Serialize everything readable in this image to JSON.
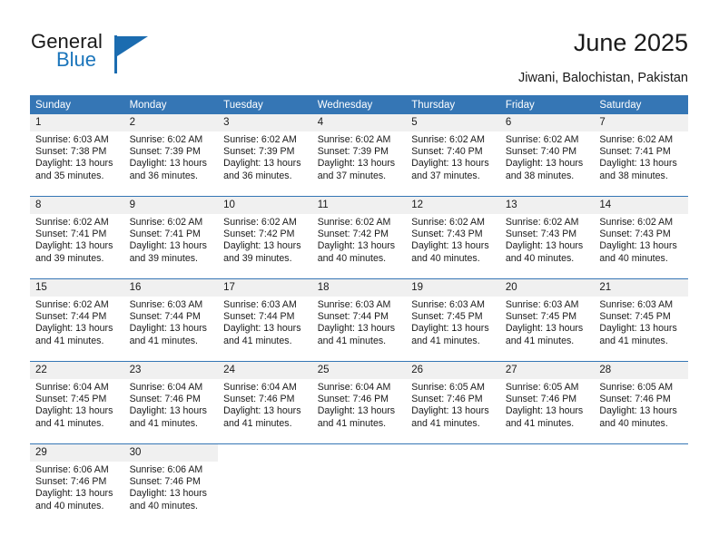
{
  "brand": {
    "name_part1": "General",
    "name_part2": "Blue",
    "accent_color": "#1b75bb"
  },
  "header": {
    "title": "June 2025",
    "location": "Jiwani, Balochistan, Pakistan"
  },
  "calendar": {
    "header_bg": "#3576b5",
    "daynum_bg": "#f0f0f0",
    "weekday_headers": [
      "Sunday",
      "Monday",
      "Tuesday",
      "Wednesday",
      "Thursday",
      "Friday",
      "Saturday"
    ],
    "weeks": [
      [
        {
          "day": "1",
          "sunrise": "Sunrise: 6:03 AM",
          "sunset": "Sunset: 7:38 PM",
          "daylight_line1": "Daylight: 13 hours",
          "daylight_line2": "and 35 minutes."
        },
        {
          "day": "2",
          "sunrise": "Sunrise: 6:02 AM",
          "sunset": "Sunset: 7:39 PM",
          "daylight_line1": "Daylight: 13 hours",
          "daylight_line2": "and 36 minutes."
        },
        {
          "day": "3",
          "sunrise": "Sunrise: 6:02 AM",
          "sunset": "Sunset: 7:39 PM",
          "daylight_line1": "Daylight: 13 hours",
          "daylight_line2": "and 36 minutes."
        },
        {
          "day": "4",
          "sunrise": "Sunrise: 6:02 AM",
          "sunset": "Sunset: 7:39 PM",
          "daylight_line1": "Daylight: 13 hours",
          "daylight_line2": "and 37 minutes."
        },
        {
          "day": "5",
          "sunrise": "Sunrise: 6:02 AM",
          "sunset": "Sunset: 7:40 PM",
          "daylight_line1": "Daylight: 13 hours",
          "daylight_line2": "and 37 minutes."
        },
        {
          "day": "6",
          "sunrise": "Sunrise: 6:02 AM",
          "sunset": "Sunset: 7:40 PM",
          "daylight_line1": "Daylight: 13 hours",
          "daylight_line2": "and 38 minutes."
        },
        {
          "day": "7",
          "sunrise": "Sunrise: 6:02 AM",
          "sunset": "Sunset: 7:41 PM",
          "daylight_line1": "Daylight: 13 hours",
          "daylight_line2": "and 38 minutes."
        }
      ],
      [
        {
          "day": "8",
          "sunrise": "Sunrise: 6:02 AM",
          "sunset": "Sunset: 7:41 PM",
          "daylight_line1": "Daylight: 13 hours",
          "daylight_line2": "and 39 minutes."
        },
        {
          "day": "9",
          "sunrise": "Sunrise: 6:02 AM",
          "sunset": "Sunset: 7:41 PM",
          "daylight_line1": "Daylight: 13 hours",
          "daylight_line2": "and 39 minutes."
        },
        {
          "day": "10",
          "sunrise": "Sunrise: 6:02 AM",
          "sunset": "Sunset: 7:42 PM",
          "daylight_line1": "Daylight: 13 hours",
          "daylight_line2": "and 39 minutes."
        },
        {
          "day": "11",
          "sunrise": "Sunrise: 6:02 AM",
          "sunset": "Sunset: 7:42 PM",
          "daylight_line1": "Daylight: 13 hours",
          "daylight_line2": "and 40 minutes."
        },
        {
          "day": "12",
          "sunrise": "Sunrise: 6:02 AM",
          "sunset": "Sunset: 7:43 PM",
          "daylight_line1": "Daylight: 13 hours",
          "daylight_line2": "and 40 minutes."
        },
        {
          "day": "13",
          "sunrise": "Sunrise: 6:02 AM",
          "sunset": "Sunset: 7:43 PM",
          "daylight_line1": "Daylight: 13 hours",
          "daylight_line2": "and 40 minutes."
        },
        {
          "day": "14",
          "sunrise": "Sunrise: 6:02 AM",
          "sunset": "Sunset: 7:43 PM",
          "daylight_line1": "Daylight: 13 hours",
          "daylight_line2": "and 40 minutes."
        }
      ],
      [
        {
          "day": "15",
          "sunrise": "Sunrise: 6:02 AM",
          "sunset": "Sunset: 7:44 PM",
          "daylight_line1": "Daylight: 13 hours",
          "daylight_line2": "and 41 minutes."
        },
        {
          "day": "16",
          "sunrise": "Sunrise: 6:03 AM",
          "sunset": "Sunset: 7:44 PM",
          "daylight_line1": "Daylight: 13 hours",
          "daylight_line2": "and 41 minutes."
        },
        {
          "day": "17",
          "sunrise": "Sunrise: 6:03 AM",
          "sunset": "Sunset: 7:44 PM",
          "daylight_line1": "Daylight: 13 hours",
          "daylight_line2": "and 41 minutes."
        },
        {
          "day": "18",
          "sunrise": "Sunrise: 6:03 AM",
          "sunset": "Sunset: 7:44 PM",
          "daylight_line1": "Daylight: 13 hours",
          "daylight_line2": "and 41 minutes."
        },
        {
          "day": "19",
          "sunrise": "Sunrise: 6:03 AM",
          "sunset": "Sunset: 7:45 PM",
          "daylight_line1": "Daylight: 13 hours",
          "daylight_line2": "and 41 minutes."
        },
        {
          "day": "20",
          "sunrise": "Sunrise: 6:03 AM",
          "sunset": "Sunset: 7:45 PM",
          "daylight_line1": "Daylight: 13 hours",
          "daylight_line2": "and 41 minutes."
        },
        {
          "day": "21",
          "sunrise": "Sunrise: 6:03 AM",
          "sunset": "Sunset: 7:45 PM",
          "daylight_line1": "Daylight: 13 hours",
          "daylight_line2": "and 41 minutes."
        }
      ],
      [
        {
          "day": "22",
          "sunrise": "Sunrise: 6:04 AM",
          "sunset": "Sunset: 7:45 PM",
          "daylight_line1": "Daylight: 13 hours",
          "daylight_line2": "and 41 minutes."
        },
        {
          "day": "23",
          "sunrise": "Sunrise: 6:04 AM",
          "sunset": "Sunset: 7:46 PM",
          "daylight_line1": "Daylight: 13 hours",
          "daylight_line2": "and 41 minutes."
        },
        {
          "day": "24",
          "sunrise": "Sunrise: 6:04 AM",
          "sunset": "Sunset: 7:46 PM",
          "daylight_line1": "Daylight: 13 hours",
          "daylight_line2": "and 41 minutes."
        },
        {
          "day": "25",
          "sunrise": "Sunrise: 6:04 AM",
          "sunset": "Sunset: 7:46 PM",
          "daylight_line1": "Daylight: 13 hours",
          "daylight_line2": "and 41 minutes."
        },
        {
          "day": "26",
          "sunrise": "Sunrise: 6:05 AM",
          "sunset": "Sunset: 7:46 PM",
          "daylight_line1": "Daylight: 13 hours",
          "daylight_line2": "and 41 minutes."
        },
        {
          "day": "27",
          "sunrise": "Sunrise: 6:05 AM",
          "sunset": "Sunset: 7:46 PM",
          "daylight_line1": "Daylight: 13 hours",
          "daylight_line2": "and 41 minutes."
        },
        {
          "day": "28",
          "sunrise": "Sunrise: 6:05 AM",
          "sunset": "Sunset: 7:46 PM",
          "daylight_line1": "Daylight: 13 hours",
          "daylight_line2": "and 40 minutes."
        }
      ],
      [
        {
          "day": "29",
          "sunrise": "Sunrise: 6:06 AM",
          "sunset": "Sunset: 7:46 PM",
          "daylight_line1": "Daylight: 13 hours",
          "daylight_line2": "and 40 minutes."
        },
        {
          "day": "30",
          "sunrise": "Sunrise: 6:06 AM",
          "sunset": "Sunset: 7:46 PM",
          "daylight_line1": "Daylight: 13 hours",
          "daylight_line2": "and 40 minutes."
        },
        {
          "day": "",
          "sunrise": "",
          "sunset": "",
          "daylight_line1": "",
          "daylight_line2": ""
        },
        {
          "day": "",
          "sunrise": "",
          "sunset": "",
          "daylight_line1": "",
          "daylight_line2": ""
        },
        {
          "day": "",
          "sunrise": "",
          "sunset": "",
          "daylight_line1": "",
          "daylight_line2": ""
        },
        {
          "day": "",
          "sunrise": "",
          "sunset": "",
          "daylight_line1": "",
          "daylight_line2": ""
        },
        {
          "day": "",
          "sunrise": "",
          "sunset": "",
          "daylight_line1": "",
          "daylight_line2": ""
        }
      ]
    ]
  }
}
